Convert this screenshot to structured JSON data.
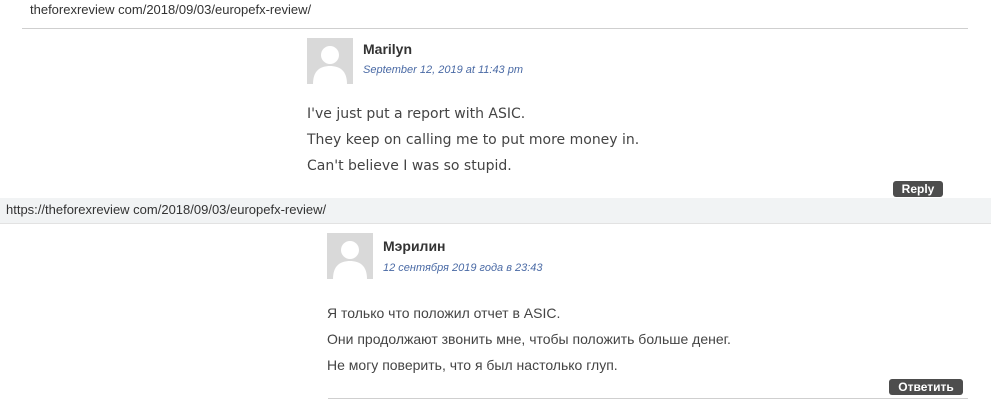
{
  "top_url": "theforexreview com/2018/09/03/europefx-review/",
  "bar_url": "https://theforexreview com/2018/09/03/europefx-review/",
  "comment_en": {
    "author": "Marilyn",
    "date": "September 12, 2019 at 11:43 pm",
    "lines": [
      "I've just put a report with ASIC.",
      "They keep on calling me to put more money in.",
      "Can't believe I was so stupid."
    ],
    "reply_label": "Reply"
  },
  "comment_ru": {
    "author": "Мэрилин",
    "date": "12 сентября 2019 года в 23:43",
    "lines": [
      "Я только что положил отчет в ASIC.",
      "Они продолжают звонить мне, чтобы положить больше денег.",
      "Не могу поверить, что я был настолько глуп."
    ],
    "reply_label": "Ответить"
  },
  "icons": {
    "avatar": "user-silhouette-icon"
  },
  "colors": {
    "reply_bg": "#4d4d4d",
    "date": "#4a6aa5",
    "avatar_bg": "#d9d9d9"
  }
}
